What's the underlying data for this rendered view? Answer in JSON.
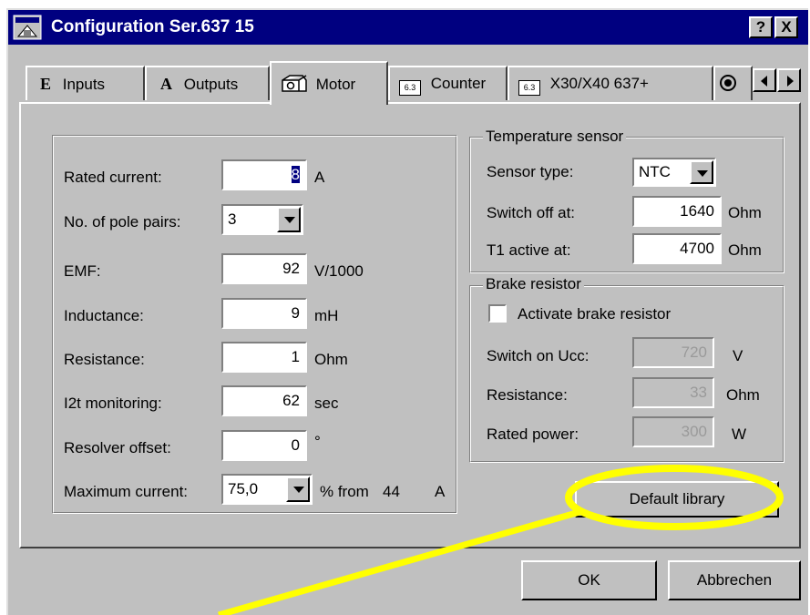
{
  "window": {
    "title": "Configuration Ser.637 15",
    "help_label": "?",
    "close_label": "X"
  },
  "tabs": [
    {
      "prefix": "E",
      "label": "Inputs"
    },
    {
      "prefix": "A",
      "label": "Outputs"
    },
    {
      "label": "Motor"
    },
    {
      "label": "Counter"
    },
    {
      "label": "X30/X40 637+"
    }
  ],
  "motor": {
    "rated_current": {
      "label": "Rated current:",
      "value": "8",
      "unit": "A"
    },
    "pole_pairs": {
      "label": "No. of pole pairs:",
      "value": "3"
    },
    "emf": {
      "label": "EMF:",
      "value": "92",
      "unit": "V/1000"
    },
    "inductance": {
      "label": "Inductance:",
      "value": "9",
      "unit": "mH"
    },
    "resistance": {
      "label": "Resistance:",
      "value": "1",
      "unit": "Ohm"
    },
    "i2t": {
      "label": "I2t monitoring:",
      "value": "62",
      "unit": "sec"
    },
    "resolver": {
      "label": "Resolver offset:",
      "value": "0",
      "unit": "°"
    },
    "max_current": {
      "label": "Maximum current:",
      "value": "75,0",
      "unit": "% from",
      "from_value": "44",
      "from_unit": "A"
    }
  },
  "temperature": {
    "title": "Temperature sensor",
    "sensor_type": {
      "label": "Sensor type:",
      "value": "NTC"
    },
    "switch_off": {
      "label": "Switch off at:",
      "value": "1640",
      "unit": "Ohm"
    },
    "t1_active": {
      "label": "T1 active at:",
      "value": "4700",
      "unit": "Ohm"
    }
  },
  "brake": {
    "title": "Brake resistor",
    "activate_label": "Activate brake resistor",
    "switch_on": {
      "label": "Switch on Ucc:",
      "value": "720",
      "unit": "V"
    },
    "resistance": {
      "label": "Resistance:",
      "value": "33",
      "unit": "Ohm"
    },
    "rated_power": {
      "label": "Rated power:",
      "value": "300",
      "unit": "W"
    }
  },
  "buttons": {
    "default_library": "Default library",
    "ok": "OK",
    "cancel": "Abbrechen"
  },
  "colors": {
    "titlebar": "#000080",
    "dialog": "#c0c0c0",
    "highlight": "#ffff00"
  }
}
